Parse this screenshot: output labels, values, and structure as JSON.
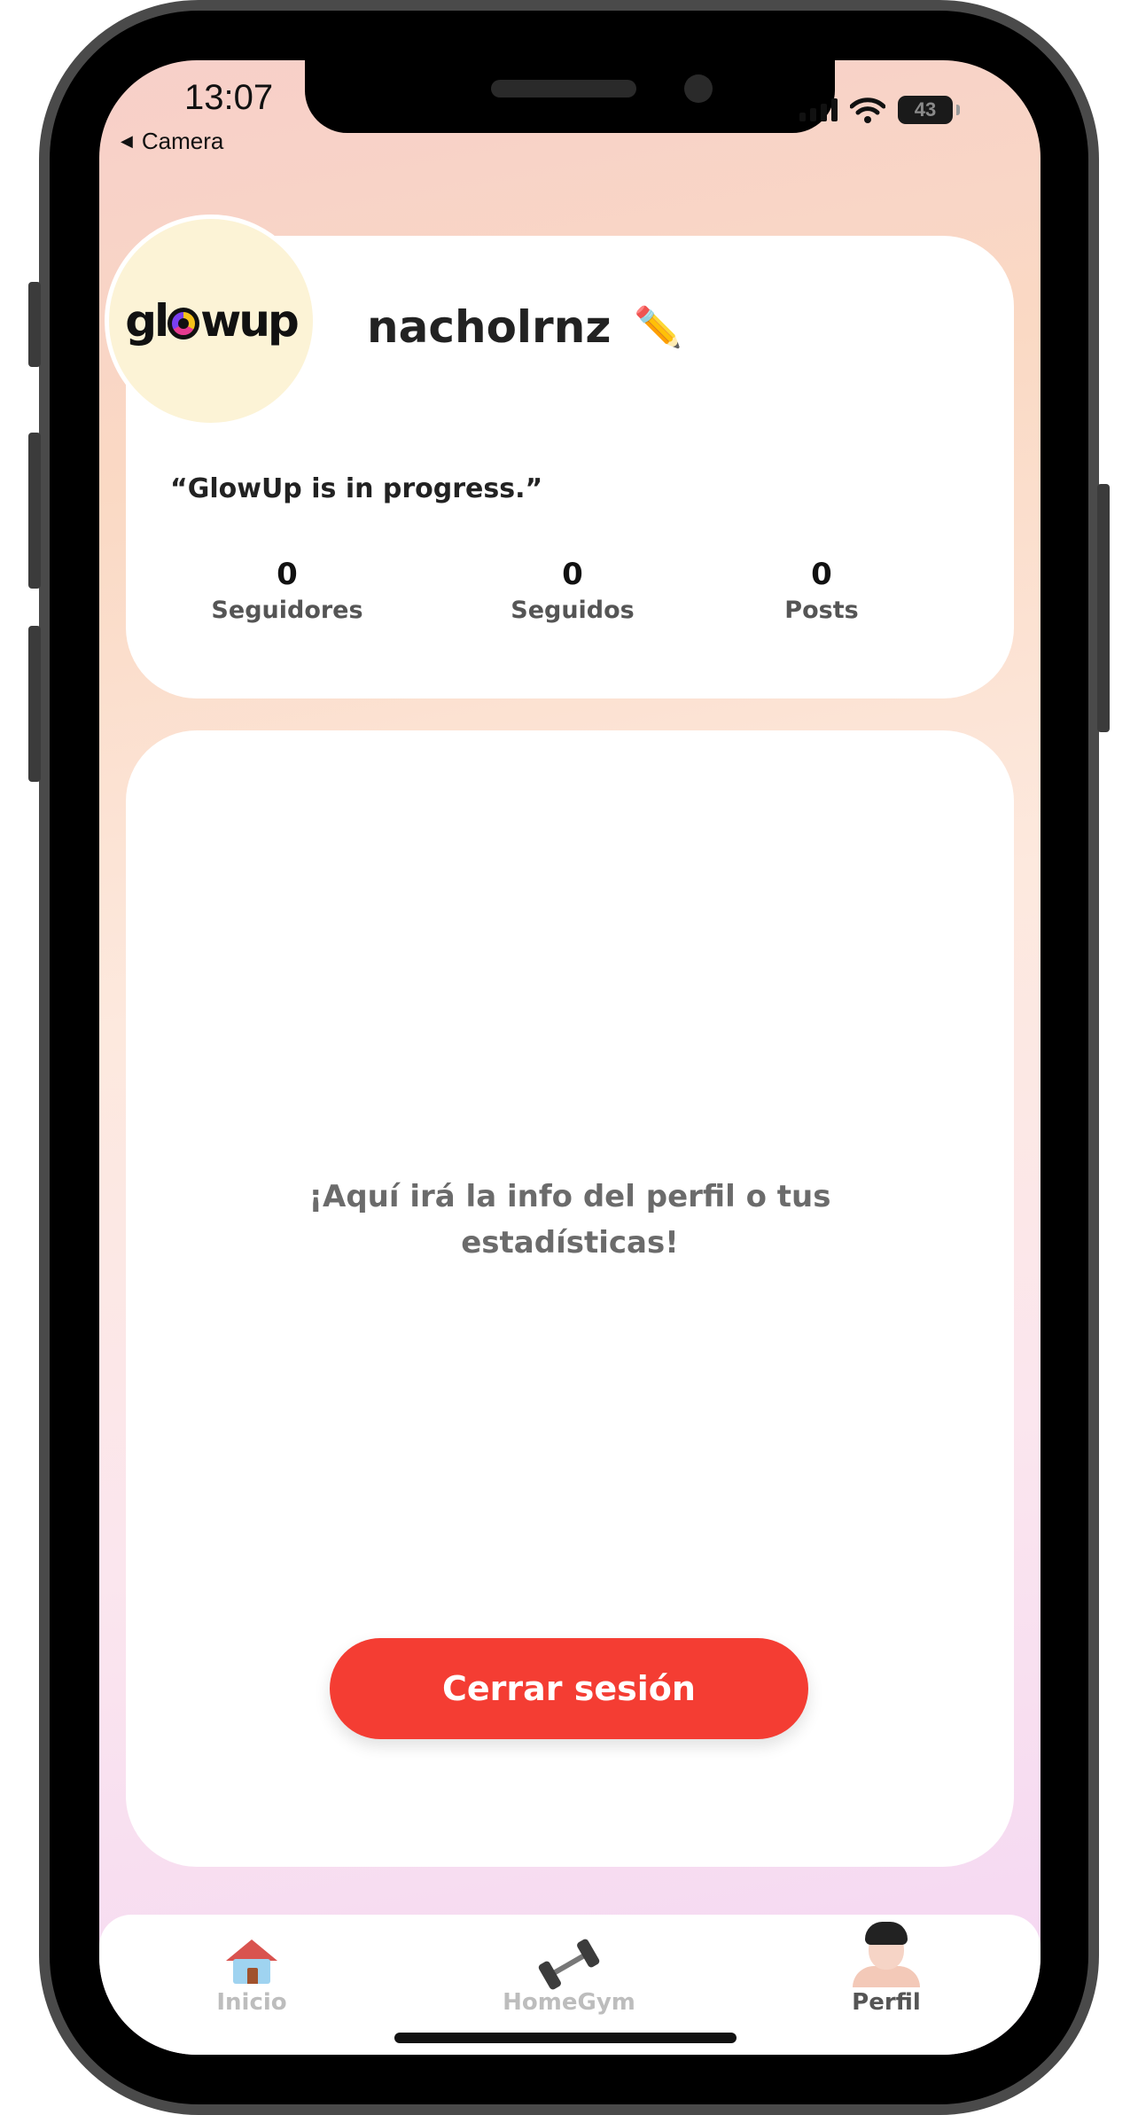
{
  "status_bar": {
    "time": "13:07",
    "back_label": "Camera",
    "battery": "43"
  },
  "profile": {
    "logo_text_before": "gl",
    "logo_text_after": "wup",
    "username": "nacholrnz",
    "edit_icon": "pencil-icon",
    "bio": "“GlowUp is in progress.”",
    "stats": [
      {
        "value": "0",
        "label": "Seguidores"
      },
      {
        "value": "0",
        "label": "Seguidos"
      },
      {
        "value": "0",
        "label": "Posts"
      }
    ]
  },
  "main": {
    "placeholder_line1": "¡Aquí irá la info del perfil o tus",
    "placeholder_line2": "estadísticas!",
    "logout_label": "Cerrar sesión"
  },
  "tabbar": {
    "tabs": [
      {
        "label": "Inicio",
        "icon": "house-icon",
        "active": false
      },
      {
        "label": "HomeGym",
        "icon": "dumbbell-icon",
        "active": false
      },
      {
        "label": "Perfil",
        "icon": "person-icon",
        "active": true
      }
    ]
  },
  "colors": {
    "accent": "#f43d33",
    "background_gradient_start": "#f7cfc9",
    "background_gradient_end": "#f4d6f3",
    "avatar_background": "#fcf3d6"
  }
}
